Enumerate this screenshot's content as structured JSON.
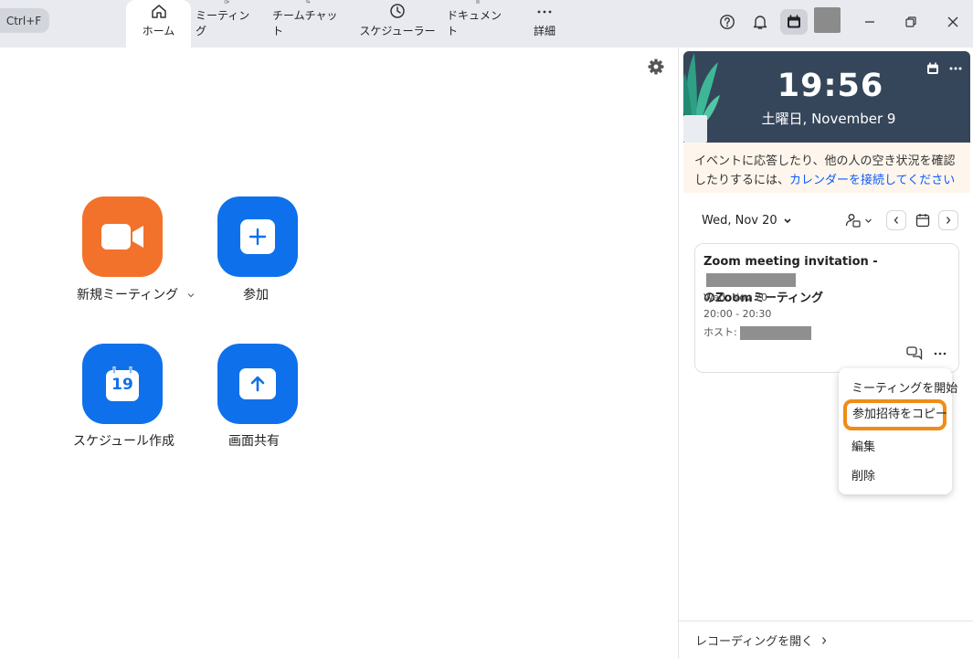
{
  "topbar": {
    "search_shortcut": "Ctrl+F",
    "tabs": [
      {
        "label": "ホーム",
        "icon": "home-icon",
        "active": true
      },
      {
        "label": "ミーティング",
        "icon": "video-camera-icon"
      },
      {
        "label": "チームチャット",
        "icon": "chat-bubbles-icon"
      },
      {
        "label": "スケジューラー",
        "icon": "clock-icon"
      },
      {
        "label": "ドキュメント",
        "icon": "document-icon"
      },
      {
        "label": "詳細",
        "icon": "more-dots-icon"
      }
    ]
  },
  "home": {
    "actions": [
      {
        "label": "新規ミーティング",
        "icon": "video-camera-icon",
        "color": "#f2722b"
      },
      {
        "label": "参加",
        "icon": "plus-icon",
        "color": "#0e71eb"
      },
      {
        "label": "スケジュール作成",
        "icon": "calendar-icon",
        "color": "#0e71eb",
        "calendar_day": "19"
      },
      {
        "label": "画面共有",
        "icon": "share-arrow-icon",
        "color": "#0e71eb"
      }
    ]
  },
  "panel": {
    "clock_time": "19:56",
    "clock_date": "土曜日, November 9",
    "notice_text": "イベントに応答したり、他の人の空き状況を確認したりするには、",
    "notice_link": "カレンダーを接続してください",
    "selected_date": "Wed, Nov 20",
    "meeting": {
      "title": "Zoom meeting invitation -",
      "title_suffix": "のZoomミーティング",
      "date": "Wed, Nov 20",
      "time": "20:00 - 20:30",
      "host_label": "ホスト:"
    },
    "menu": [
      {
        "label": "ミーティングを開始"
      },
      {
        "label": "参加招待をコピー",
        "highlighted": true
      },
      {
        "label": "編集"
      },
      {
        "label": "削除"
      }
    ],
    "recording_link": "レコーディングを開く"
  },
  "colors": {
    "accent_blue": "#0e71eb",
    "accent_orange": "#f2722b",
    "highlight_outline": "#f08c18",
    "clock_bg": "#36465a"
  }
}
